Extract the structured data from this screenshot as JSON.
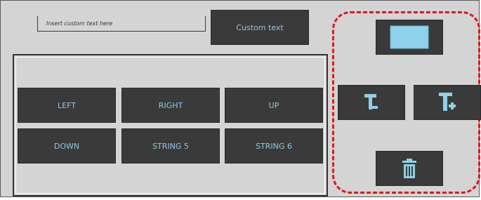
{
  "input": {
    "placeholder": "Insert custom text here"
  },
  "custom_text_button": {
    "label": "Custom text"
  },
  "direction_buttons": [
    {
      "label": "LEFT"
    },
    {
      "label": "RIGHT"
    },
    {
      "label": "UP"
    },
    {
      "label": "DOWN"
    },
    {
      "label": "STRING 5"
    },
    {
      "label": "STRING 6"
    }
  ],
  "icons": {
    "add_block": "rectangle-icon",
    "decrease_text": "text-decrease-icon",
    "increase_text": "text-increase-icon",
    "delete": "trash-icon"
  },
  "colors": {
    "panel_bg": "#d4d4d4",
    "button_bg": "#3a3a3a",
    "button_text": "#8fc9e6",
    "accent_icon": "#8fd1ea",
    "dashed_highlight": "#e0161b"
  }
}
